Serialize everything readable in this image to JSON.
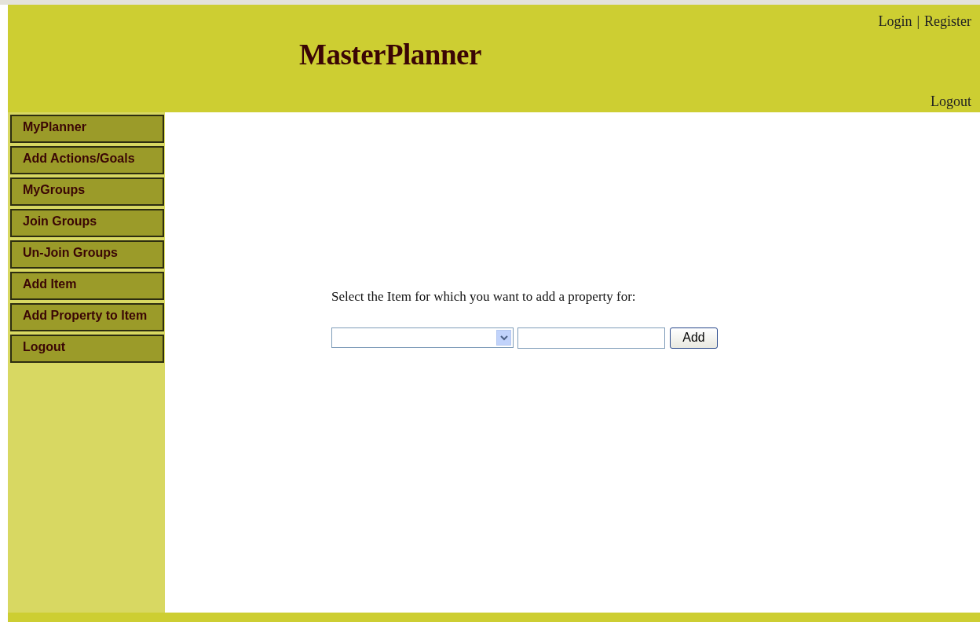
{
  "header": {
    "title": "MasterPlanner",
    "top_links": [
      "Login",
      "Register"
    ],
    "separator": "|",
    "logout": "Logout"
  },
  "sidebar": {
    "items": [
      "MyPlanner",
      "Add Actions/Goals",
      "MyGroups",
      "Join Groups",
      "Un-Join Groups",
      "Add Item",
      "Add Property to Item",
      "Logout"
    ]
  },
  "form": {
    "prompt": "Select the Item for which you want to add a property for:",
    "button": "Add"
  }
}
